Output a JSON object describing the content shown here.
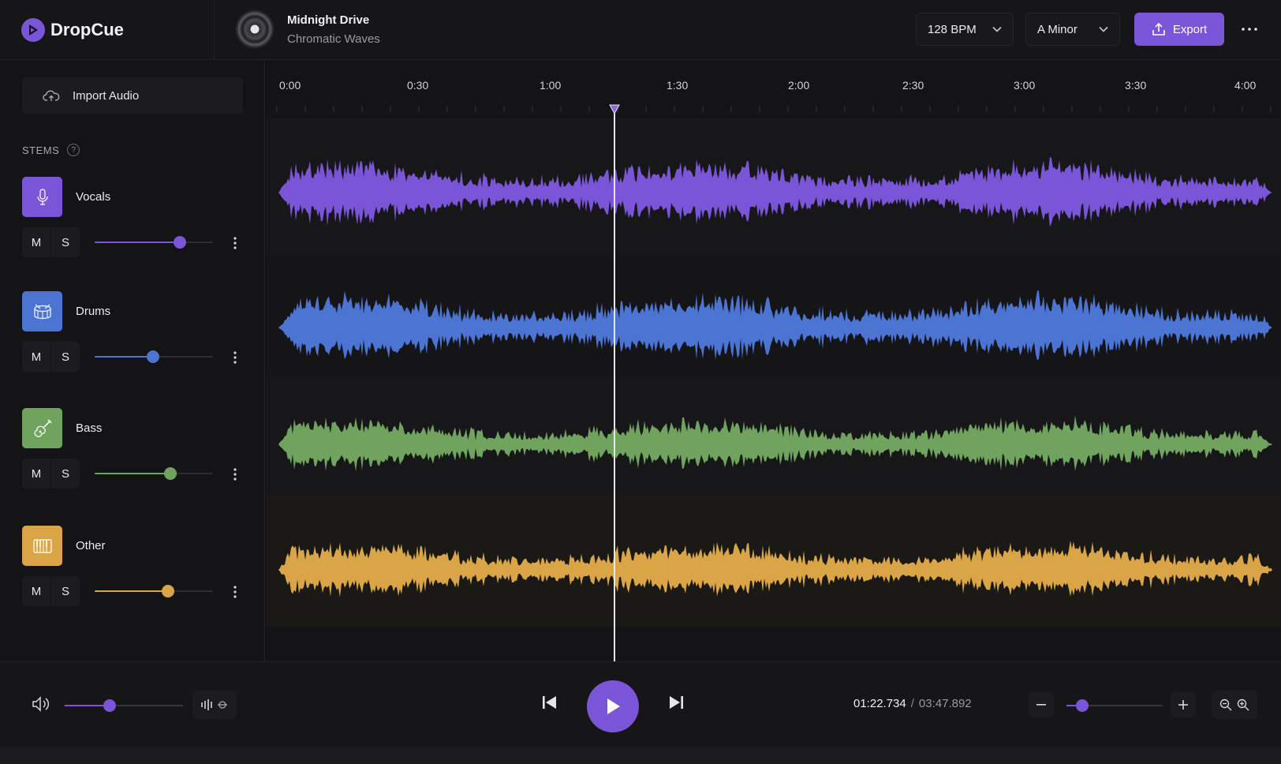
{
  "app": {
    "name": "DropCue"
  },
  "track": {
    "title": "Midnight Drive",
    "artist": "Chromatic Waves"
  },
  "header": {
    "bpm": "128 BPM",
    "key": "A Minor",
    "export_label": "Export"
  },
  "sidebar": {
    "import_label": "Import Audio",
    "stems_heading": "STEMS",
    "stems": [
      {
        "name": "Vocals",
        "icon": "microphone-icon",
        "color": "#7a55d8",
        "mute": "M",
        "solo": "S",
        "volume": 0.72
      },
      {
        "name": "Drums",
        "icon": "drum-icon",
        "color": "#4c74d2",
        "mute": "M",
        "solo": "S",
        "volume": 0.49
      },
      {
        "name": "Bass",
        "icon": "guitar-icon",
        "color": "#6fa35e",
        "mute": "M",
        "solo": "S",
        "volume": 0.64
      },
      {
        "name": "Other",
        "icon": "keyboard-icon",
        "color": "#d9a547",
        "mute": "M",
        "solo": "S",
        "volume": 0.62
      }
    ]
  },
  "timeline": {
    "ruler_labels": [
      "0:00",
      "0:30",
      "1:00",
      "1:30",
      "2:00",
      "2:30",
      "3:00",
      "3:30",
      "4:00"
    ],
    "playhead_time": "01:22.734"
  },
  "transport": {
    "current_time": "01:22.734",
    "separator": "/",
    "duration": "03:47.892",
    "master_volume": 0.38,
    "zoom_level": 0.16
  }
}
